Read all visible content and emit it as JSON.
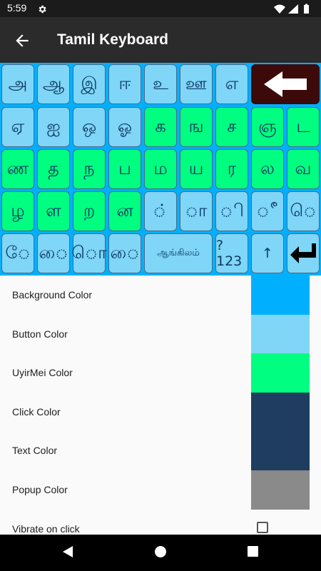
{
  "status_bar": {
    "time": "5:59",
    "icons": [
      "settings-gear-icon",
      "wifi-icon",
      "signal-icon",
      "battery-icon"
    ]
  },
  "app_bar": {
    "title": "Tamil Keyboard",
    "back_icon": "arrow-left-icon"
  },
  "keyboard": {
    "background_color": "#00b0ff",
    "rows": [
      [
        {
          "label": "அ",
          "type": "vowel"
        },
        {
          "label": "ஆ",
          "type": "vowel"
        },
        {
          "label": "இ",
          "type": "vowel"
        },
        {
          "label": "ஈ",
          "type": "vowel"
        },
        {
          "label": "உ",
          "type": "vowel"
        },
        {
          "label": "ஊ",
          "type": "vowel"
        },
        {
          "label": "எ",
          "type": "vowel"
        },
        {
          "label": "",
          "type": "back",
          "icon": "backspace-arrow-icon"
        }
      ],
      [
        {
          "label": "ஏ",
          "type": "vowel"
        },
        {
          "label": "ஐ",
          "type": "vowel"
        },
        {
          "label": "ஒ",
          "type": "vowel"
        },
        {
          "label": "ஓ",
          "type": "vowel"
        },
        {
          "label": "க",
          "type": "uyirmei"
        },
        {
          "label": "ங",
          "type": "uyirmei"
        },
        {
          "label": "ச",
          "type": "uyirmei"
        },
        {
          "label": "ஞ",
          "type": "uyirmei"
        },
        {
          "label": "ட",
          "type": "uyirmei"
        }
      ],
      [
        {
          "label": "ண",
          "type": "uyirmei"
        },
        {
          "label": "த",
          "type": "uyirmei"
        },
        {
          "label": "ந",
          "type": "uyirmei"
        },
        {
          "label": "ப",
          "type": "uyirmei"
        },
        {
          "label": "ம",
          "type": "uyirmei"
        },
        {
          "label": "ய",
          "type": "uyirmei"
        },
        {
          "label": "ர",
          "type": "uyirmei"
        },
        {
          "label": "ல",
          "type": "uyirmei"
        },
        {
          "label": "வ",
          "type": "uyirmei"
        }
      ],
      [
        {
          "label": "ழ",
          "type": "uyirmei"
        },
        {
          "label": "ள",
          "type": "uyirmei"
        },
        {
          "label": "ற",
          "type": "uyirmei"
        },
        {
          "label": "ன",
          "type": "uyirmei"
        },
        {
          "label": "◌்",
          "type": "vowel"
        },
        {
          "label": "◌ா",
          "type": "vowel"
        },
        {
          "label": "◌ி",
          "type": "vowel"
        },
        {
          "label": "◌ீ",
          "type": "vowel"
        },
        {
          "label": "◌ெ",
          "type": "vowel"
        }
      ],
      [
        {
          "label": "◌ே",
          "type": "vowel"
        },
        {
          "label": "◌ை",
          "type": "vowel"
        },
        {
          "label": "◌ொ",
          "type": "vowel"
        },
        {
          "label": "◌ை",
          "type": "vowel"
        },
        {
          "label": "ஆங்கிலம்",
          "type": "vowel",
          "size": "small"
        },
        {
          "label": "?123",
          "type": "vowel",
          "size": "medium"
        },
        {
          "label": "↑",
          "type": "vowel",
          "size": "medium"
        },
        {
          "label": "",
          "type": "vowel",
          "icon": "enter-arrow-icon"
        }
      ]
    ]
  },
  "settings": [
    {
      "label": "Background Color",
      "color": "#00b0ff"
    },
    {
      "label": "Button Color",
      "color": "#7fd6f7"
    },
    {
      "label": "UyirMei Color",
      "color": "#00ff80"
    },
    {
      "label": "Click Color",
      "color": "#1e3d60"
    },
    {
      "label": "Text Color",
      "color": "#1e3d60"
    },
    {
      "label": "Popup Color",
      "color": "#8a8a8a"
    },
    {
      "label": "Vibrate on click",
      "checked": false
    }
  ],
  "nav_bar": {
    "icons": [
      "nav-back-icon",
      "nav-home-icon",
      "nav-recent-icon"
    ]
  }
}
